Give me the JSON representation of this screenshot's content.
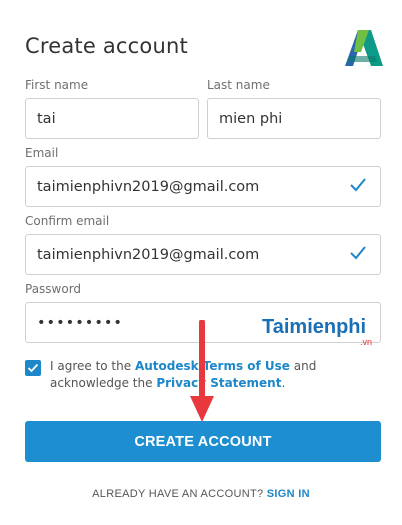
{
  "title": "Create account",
  "first_name": {
    "label": "First name",
    "value": "tai"
  },
  "last_name": {
    "label": "Last name",
    "value": "mien phi"
  },
  "email": {
    "label": "Email",
    "value": "taimienphivn2019@gmail.com"
  },
  "confirm_email": {
    "label": "Confirm email",
    "value": "taimienphivn2019@gmail.com"
  },
  "password": {
    "label": "Password",
    "value": "•••••••••"
  },
  "agree": {
    "prefix": "I agree to the ",
    "terms_link": "Autodesk Terms of Use",
    "middle": " and acknowledge the ",
    "privacy_link": "Privacy Statement",
    "suffix": ".",
    "checked": true
  },
  "create_button": "CREATE ACCOUNT",
  "already_text": "ALREADY HAVE AN ACCOUNT? ",
  "sign_in_link": "SIGN IN",
  "watermark": {
    "text": "Taimienphi",
    "sub": ".vn"
  },
  "colors": {
    "accent": "#1d8ed0",
    "arrow": "#e8383d"
  },
  "icons": {
    "logo": "autodesk-logo-icon",
    "check": "check-icon"
  }
}
